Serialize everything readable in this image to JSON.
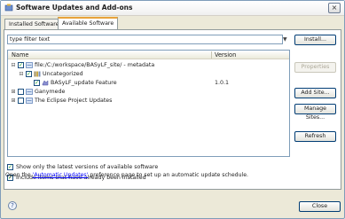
{
  "window": {
    "title": "Software Updates and Add-ons",
    "close": "×"
  },
  "tabs": [
    {
      "label": "Installed Software",
      "active": false
    },
    {
      "label": "Available Software",
      "active": true
    }
  ],
  "filter": {
    "value": "type filter text",
    "dropdown": "▼"
  },
  "buttons": {
    "install": "Install...",
    "properties": "Properties",
    "add_site": "Add Site...",
    "manage_sites": "Manage Sites...",
    "refresh": "Refresh",
    "close": "Close"
  },
  "tree": {
    "columns": {
      "name": "Name",
      "version": "Version"
    },
    "rows": [
      {
        "label": "file:/C:/workspace/BASyLF_site/ - metadata",
        "version": "",
        "expander": "⊟",
        "checked": true
      },
      {
        "label": "Uncategorized",
        "version": "",
        "expander": "⊟",
        "checked": true
      },
      {
        "label": "BASyLF_update Feature",
        "version": "1.0.1",
        "expander": "",
        "checked": true
      },
      {
        "label": "Ganymede",
        "version": "",
        "expander": "⊞",
        "checked": false
      },
      {
        "label": "The Eclipse Project Updates",
        "version": "",
        "expander": "⊞",
        "checked": false
      }
    ]
  },
  "options": [
    {
      "label": "Show only the latest versions of available software",
      "checked": true
    },
    {
      "label": "Include items that have already been installed",
      "checked": true
    }
  ],
  "footer": {
    "prefix": "Open the ",
    "link": "'Automatic Updates'",
    "suffix": " preference page to set up an automatic update schedule."
  },
  "help": "?",
  "icons": {
    "window": "update-icon",
    "site": "site-icon",
    "category": "category-icon",
    "feature": "feature-icon"
  },
  "colors": {
    "accent_tab": "#e8a33b",
    "check": "#21a121",
    "link": "#0000ff"
  }
}
